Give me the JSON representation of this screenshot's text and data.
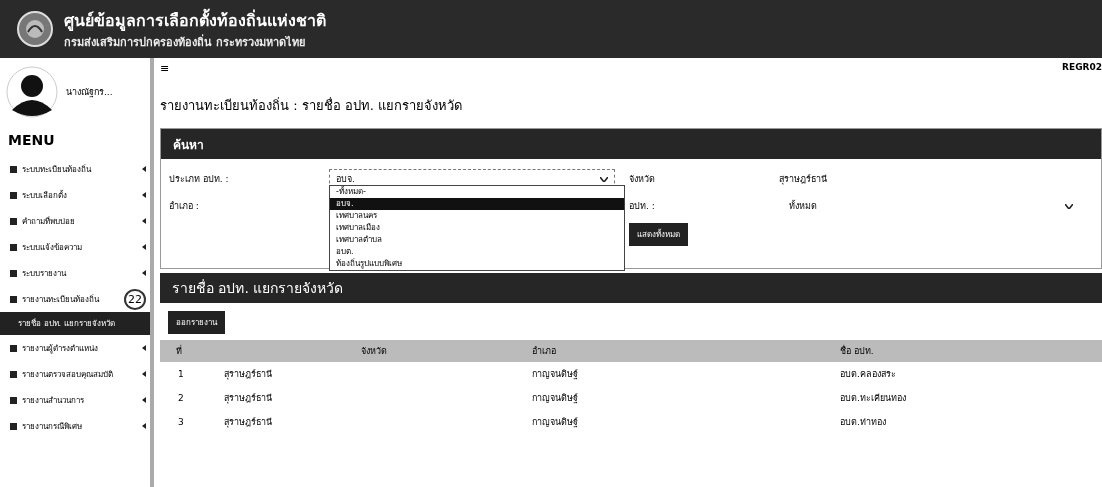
{
  "header": {
    "title": "ศูนย์ข้อมูลการเลือกตั้งท้องถิ่นแห่งชาติ",
    "subtitle": "กรมส่งเสริมการปกครองท้องถิ่น กระทรวงมหาดไทย"
  },
  "user": {
    "name": "นางณัฐกร..."
  },
  "menu_title": "MENU",
  "sidebar": {
    "items": [
      {
        "label": "ระบบทะเบียนท้องถิ่น"
      },
      {
        "label": "ระบบเลือกตั้ง"
      },
      {
        "label": "คำถามที่พบบ่อย"
      },
      {
        "label": "ระบบแจ้งข้อความ"
      },
      {
        "label": "ระบบรายงาน"
      },
      {
        "label": "รายงานทะเบียนท้องถิ่น",
        "badge": "22",
        "children": [
          {
            "label": "รายชื่อ อปท. แยกรายจังหวัด",
            "selected": true
          }
        ]
      },
      {
        "label": "รายงานผู้ดำรงตำแหน่ง"
      },
      {
        "label": "รายงานตรวจสอบคุณสมบัติ"
      },
      {
        "label": "รายงานสำนวนการ"
      },
      {
        "label": "รายงานกรณีพิเศษ"
      }
    ]
  },
  "menu_icon": "≡",
  "report_code": "REGR02",
  "page_title": "รายงานทะเบียนท้องถิ่น : รายชื่อ อปท. แยกรายจังหวัด",
  "search": {
    "title": "ค้นหา",
    "type_label": "ประเภท อปท. :",
    "type_value": "อบจ.",
    "type_options": [
      {
        "label": "-ทั้งหมด-",
        "selected": false
      },
      {
        "label": "อบจ.",
        "selected": true
      },
      {
        "label": "เทศบาลนคร",
        "selected": false
      },
      {
        "label": "เทศบาลเมือง",
        "selected": false
      },
      {
        "label": "เทศบาลตำบล",
        "selected": false
      },
      {
        "label": "อบต.",
        "selected": false
      },
      {
        "label": "ท้องถิ่นรูปแบบพิเศษ",
        "selected": false
      }
    ],
    "province_label": "จังหวัด",
    "province_value": "สุราษฎร์ธานี",
    "district_label": "อำเภอ :",
    "lao_label": "อปท. :",
    "lao_value": "ทั้งหมด",
    "show_all_button": "แสดงทั้งหมด"
  },
  "results": {
    "title": "รายชื่อ อปท. แยกรายจังหวัด",
    "export_button": "ออกรายงาน",
    "columns": [
      "ที่",
      "จังหวัด",
      "อำเภอ",
      "ชื่อ อปท."
    ],
    "rows": [
      [
        "1",
        "สุราษฎร์ธานี",
        "กาญจนดิษฐ์",
        "อบต.คลองสระ"
      ],
      [
        "2",
        "สุราษฎร์ธานี",
        "กาญจนดิษฐ์",
        "อบต.ทะเคียนทอง"
      ],
      [
        "3",
        "สุราษฎร์ธานี",
        "กาญจนดิษฐ์",
        "อบต.ท่าทอง"
      ]
    ]
  }
}
